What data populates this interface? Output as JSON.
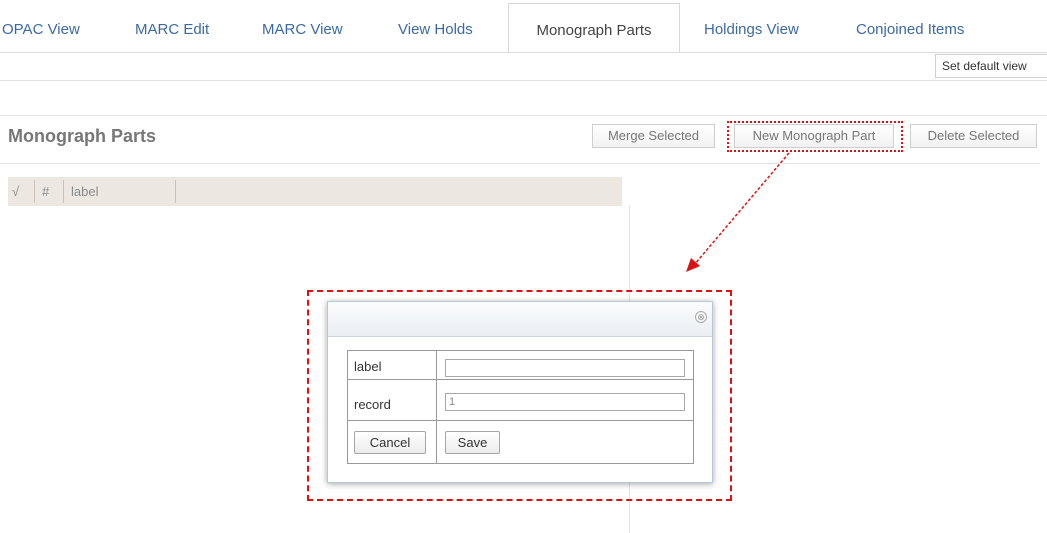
{
  "tabs": [
    {
      "label": "OPAC View"
    },
    {
      "label": "MARC Edit"
    },
    {
      "label": "MARC View"
    },
    {
      "label": "View Holds"
    },
    {
      "label": "Monograph Parts"
    },
    {
      "label": "Holdings View"
    },
    {
      "label": "Conjoined Items"
    }
  ],
  "active_tab": "Monograph Parts",
  "set_default_label": "Set default view",
  "page_title": "Monograph Parts",
  "toolbar": {
    "merge_label": "Merge Selected",
    "new_label": "New Monograph Part",
    "delete_label": "Delete Selected"
  },
  "grid": {
    "columns": [
      "√",
      "#",
      "label"
    ]
  },
  "dialog": {
    "close_glyph": "⊗",
    "fields": [
      {
        "label": "label",
        "value": ""
      },
      {
        "label": "record",
        "value": "1"
      }
    ],
    "cancel_label": "Cancel",
    "save_label": "Save"
  },
  "colors": {
    "annotation": "#dd1111",
    "tab_link": "#3b6aa3"
  }
}
